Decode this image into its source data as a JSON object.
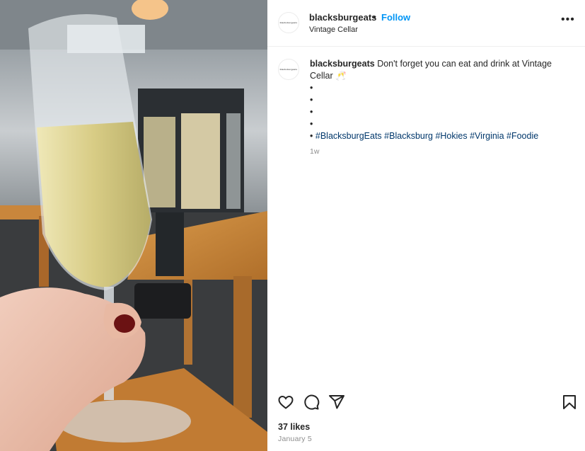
{
  "post": {
    "photo_alt": "Hand holding a glass of champagne in a restaurant",
    "header": {
      "avatar_text": "blacksburgeats",
      "username": "blacksburgeats",
      "separator": "•",
      "follow_label": "Follow",
      "location": "Vintage Cellar",
      "more_label": "•••"
    },
    "caption": {
      "avatar_text": "blacksburgeats",
      "username": "blacksburgeats",
      "text": "Don't forget you can eat and drink at Vintage Cellar 🥂",
      "bullets": [
        "•",
        "•",
        "•",
        "•"
      ],
      "last_bullet": "•",
      "hashtags": [
        "#BlacksburgEats",
        "#Blacksburg",
        "#Hokies",
        "#Virginia",
        "#Foodie"
      ],
      "time": "1w"
    },
    "actions": {
      "like": "heart-icon",
      "comment": "comment-icon",
      "share": "share-icon",
      "save": "bookmark-icon"
    },
    "likes": "37 likes",
    "date": "January 5"
  },
  "colors": {
    "follow": "#0095f6",
    "hashtag": "#00376b",
    "muted": "#8e8e8e",
    "text": "#262626"
  }
}
